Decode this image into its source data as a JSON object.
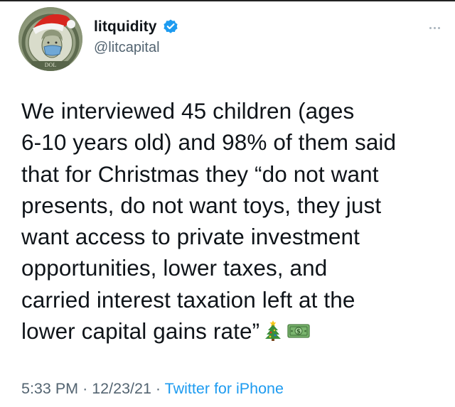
{
  "tweet": {
    "author": {
      "display_name": "litquidity",
      "handle": "@litcapital",
      "verified": true,
      "avatar_icon": "dollar-bill-santa-hat-avatar"
    },
    "more_icon": "more-horizontal-icon",
    "text_lines": [
      "We interviewed 45 children (ages",
      "6-10 years old) and 98% of them said",
      "that for Christmas they “do not want",
      "presents, do not want toys, they just",
      "want access to private investment",
      "opportunities, lower taxes, and",
      "carried interest taxation left at the",
      "lower capital gains rate”"
    ],
    "emojis": [
      "christmas-tree-icon",
      "dollar-banknote-icon"
    ],
    "time": "5:33 PM",
    "date": "12/23/21",
    "separator": "·",
    "source": "Twitter for iPhone"
  },
  "colors": {
    "text": "#0f1419",
    "secondary": "#536471",
    "link": "#1d9bf0",
    "verified": "#1d9bf0"
  }
}
